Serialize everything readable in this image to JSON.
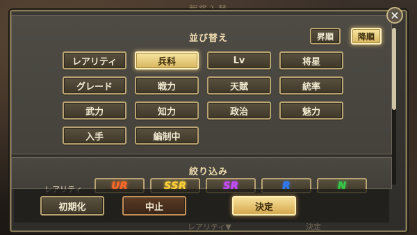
{
  "background": {
    "title": "戦将入替"
  },
  "sort": {
    "title": "並び替え",
    "order_buttons": [
      {
        "label": "昇順",
        "active": false
      },
      {
        "label": "降順",
        "active": true
      }
    ],
    "options": [
      {
        "label": "レアリティ",
        "active": false
      },
      {
        "label": "兵科",
        "active": true
      },
      {
        "label": "Lv",
        "active": false
      },
      {
        "label": "将星",
        "active": false
      },
      {
        "label": "グレード",
        "active": false
      },
      {
        "label": "戦力",
        "active": false
      },
      {
        "label": "天賦",
        "active": false
      },
      {
        "label": "統率",
        "active": false
      },
      {
        "label": "武力",
        "active": false
      },
      {
        "label": "知力",
        "active": false
      },
      {
        "label": "政治",
        "active": false
      },
      {
        "label": "魅力",
        "active": false
      },
      {
        "label": "入手",
        "active": false
      },
      {
        "label": "編制中",
        "active": false
      }
    ]
  },
  "filter": {
    "title": "絞り込み",
    "rarity_label": "レアリティ",
    "rarities": [
      {
        "label": "UR",
        "color": "#ff6a2a"
      },
      {
        "label": "SSR",
        "color": "#ffd23a"
      },
      {
        "label": "SR",
        "color": "#c44dff"
      },
      {
        "label": "R",
        "color": "#2f7dff"
      },
      {
        "label": "N",
        "color": "#38c94a"
      }
    ]
  },
  "footer": {
    "reset_label": "初期化",
    "cancel_label": "中止",
    "confirm_label": "決定"
  },
  "under_ui": {
    "tab_label": "レアリティ▼",
    "confirm_label": "決定"
  },
  "colors": {
    "accent_gold": "#d7b55e",
    "frame": "#8a7a55"
  }
}
